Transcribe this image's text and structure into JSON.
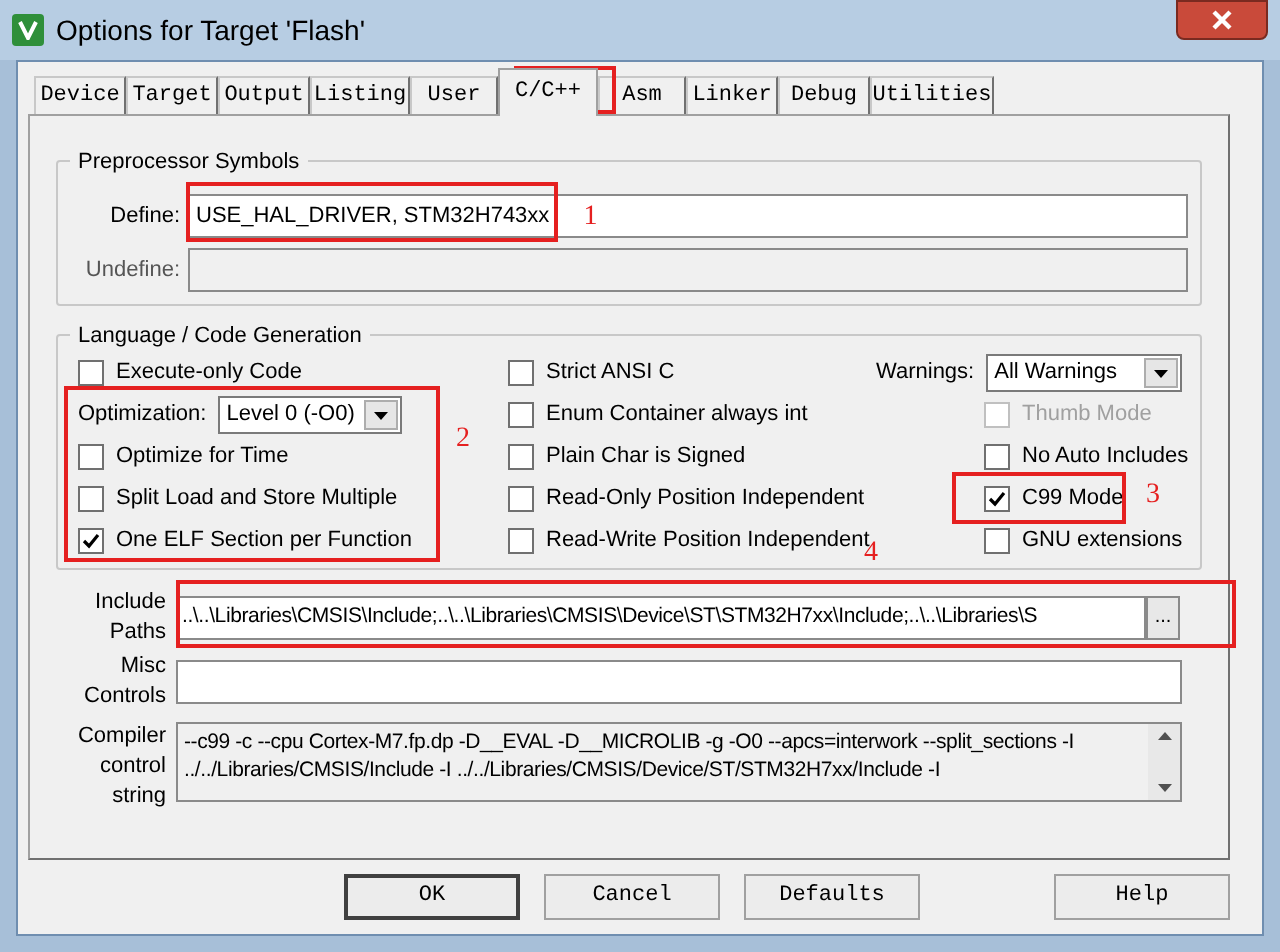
{
  "window": {
    "title": "Options for Target 'Flash'"
  },
  "tabs": [
    {
      "label": "Device",
      "selected": false
    },
    {
      "label": "Target",
      "selected": false
    },
    {
      "label": "Output",
      "selected": false
    },
    {
      "label": "Listing",
      "selected": false
    },
    {
      "label": "User",
      "selected": false
    },
    {
      "label": "C/C++",
      "selected": true
    },
    {
      "label": "Asm",
      "selected": false
    },
    {
      "label": "Linker",
      "selected": false
    },
    {
      "label": "Debug",
      "selected": false
    },
    {
      "label": "Utilities",
      "selected": false
    }
  ],
  "preprocessor": {
    "title": "Preprocessor Symbols",
    "define": {
      "label": "Define:",
      "value": "USE_HAL_DRIVER, STM32H743xx",
      "disabled": false
    },
    "undefine": {
      "label": "Undefine:",
      "disabled": true
    }
  },
  "language": {
    "title": "Language / Code Generation",
    "columns": [
      [
        {
          "kind": "checkbox",
          "label": "Execute-only Code",
          "checked": false,
          "disabled": false
        },
        {
          "kind": "select",
          "label": "Optimization:",
          "value": "Level 0 (-O0)"
        },
        {
          "kind": "checkbox",
          "label": "Optimize for Time",
          "checked": false,
          "disabled": false
        },
        {
          "kind": "checkbox",
          "label": "Split Load and Store Multiple",
          "checked": false,
          "disabled": false
        },
        {
          "kind": "checkbox",
          "label": "One ELF Section per Function",
          "checked": true,
          "disabled": false
        }
      ],
      [
        {
          "kind": "checkbox",
          "label": "Strict ANSI C",
          "checked": false,
          "disabled": false
        },
        {
          "kind": "checkbox",
          "label": "Enum Container always int",
          "checked": false,
          "disabled": false
        },
        {
          "kind": "checkbox",
          "label": "Plain Char is Signed",
          "checked": false,
          "disabled": false
        },
        {
          "kind": "checkbox",
          "label": "Read-Only Position Independent",
          "checked": false,
          "disabled": false
        },
        {
          "kind": "checkbox",
          "label": "Read-Write Position Independent",
          "checked": false,
          "disabled": false
        }
      ],
      [
        {
          "kind": "select",
          "label": "Warnings:",
          "value": "All Warnings"
        },
        {
          "kind": "checkbox",
          "label": "Thumb Mode",
          "checked": false,
          "disabled": true
        },
        {
          "kind": "checkbox",
          "label": "No Auto Includes",
          "checked": false,
          "disabled": false
        },
        {
          "kind": "checkbox",
          "label": "C99 Mode",
          "checked": true,
          "disabled": false
        },
        {
          "kind": "checkbox",
          "label": "GNU extensions",
          "checked": false,
          "disabled": false
        }
      ]
    ]
  },
  "include_paths": {
    "label": [
      "Include",
      "Paths"
    ],
    "value": "..\\..\\Libraries\\CMSIS\\Include;..\\..\\Libraries\\CMSIS\\Device\\ST\\STM32H7xx\\Include;..\\..\\Libraries\\S",
    "browse": "..."
  },
  "misc_controls": {
    "label": [
      "Misc",
      "Controls"
    ]
  },
  "compiler_string": {
    "label": [
      "Compiler",
      "control",
      "string"
    ],
    "lines": [
      "--c99 -c --cpu Cortex-M7.fp.dp -D__EVAL -D__MICROLIB -g -O0 --apcs=interwork --split_sections -I",
      "../../Libraries/CMSIS/Include -I ../../Libraries/CMSIS/Device/ST/STM32H7xx/Include -I"
    ]
  },
  "buttons": [
    {
      "label": "OK",
      "default": true
    },
    {
      "label": "Cancel",
      "default": false
    },
    {
      "label": "Defaults",
      "default": false
    },
    {
      "label": "Help",
      "default": false
    }
  ],
  "annotations": [
    {
      "label": "1"
    },
    {
      "label": "2"
    },
    {
      "label": "3"
    },
    {
      "label": "4"
    }
  ]
}
